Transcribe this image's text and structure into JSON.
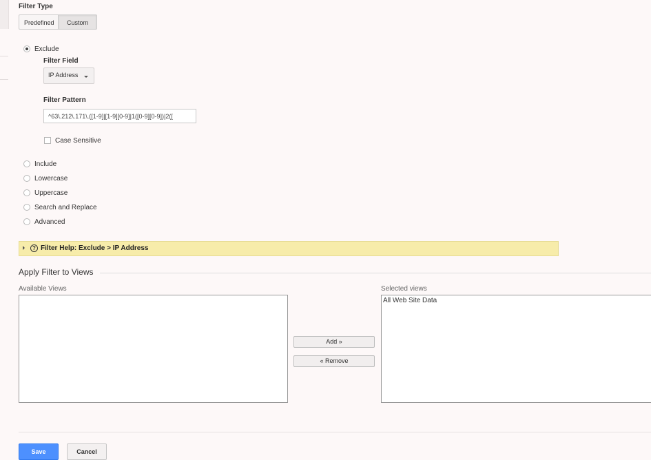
{
  "filter_type": {
    "heading": "Filter Type",
    "tabs": [
      "Predefined",
      "Custom"
    ],
    "selected_tab": "Custom"
  },
  "options": {
    "exclude": "Exclude",
    "include": "Include",
    "lowercase": "Lowercase",
    "uppercase": "Uppercase",
    "search_replace": "Search and Replace",
    "advanced": "Advanced",
    "selected": "Exclude"
  },
  "exclude_panel": {
    "field_label": "Filter Field",
    "field_value": "IP Address",
    "pattern_label": "Filter Pattern",
    "pattern_value": "^63\\.212\\.171\\.([1-9]|[1-9][0-9]|1([0-9][0-9])|2([",
    "case_sensitive_label": "Case Sensitive",
    "case_sensitive_checked": false
  },
  "help": {
    "text": "Filter Help: Exclude  >  IP Address",
    "icon": "question-circle-icon"
  },
  "apply": {
    "title": "Apply Filter to Views",
    "available_label": "Available Views",
    "available_items": [],
    "selected_label": "Selected views",
    "selected_items": [
      "All Web Site Data"
    ],
    "add_label": "Add »",
    "remove_label": "« Remove"
  },
  "actions": {
    "save": "Save",
    "cancel": "Cancel"
  },
  "colors": {
    "background": "#fdf8f8",
    "help_bar": "#f7ecaa",
    "save_button": "#4d90fe"
  }
}
